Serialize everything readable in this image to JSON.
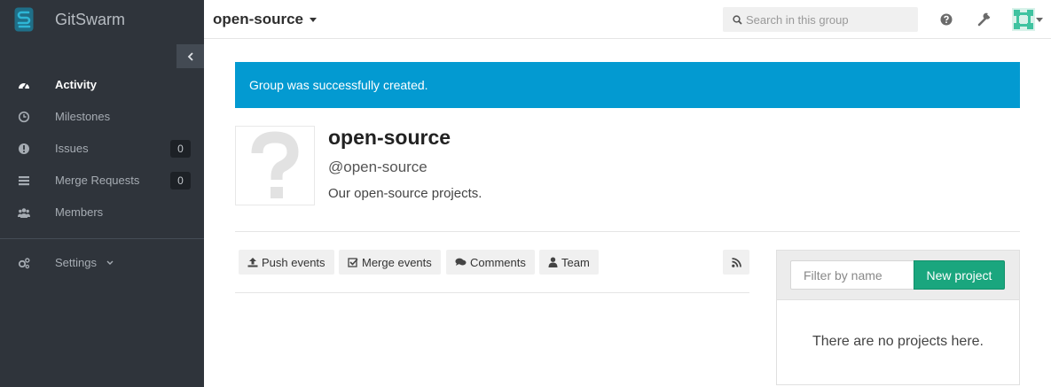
{
  "app": {
    "name": "GitSwarm"
  },
  "sidebar": {
    "items": [
      {
        "label": "Activity",
        "icon": "dashboard-icon",
        "active": true
      },
      {
        "label": "Milestones",
        "icon": "clock-icon"
      },
      {
        "label": "Issues",
        "icon": "exclamation-icon",
        "count": "0"
      },
      {
        "label": "Merge Requests",
        "icon": "list-icon",
        "count": "0"
      },
      {
        "label": "Members",
        "icon": "users-icon"
      }
    ],
    "settings_label": "Settings"
  },
  "header": {
    "group_title": "open-source",
    "search_placeholder": "Search in this group"
  },
  "flash": {
    "message": "Group was successfully created."
  },
  "group": {
    "name": "open-source",
    "path": "@open-source",
    "description": "Our open-source projects."
  },
  "event_filters": {
    "push": "Push events",
    "merge": "Merge events",
    "comments": "Comments",
    "team": "Team"
  },
  "projects": {
    "filter_placeholder": "Filter by name",
    "new_button": "New project",
    "empty_text": "There are no projects here."
  },
  "colors": {
    "sidebar_bg": "#2f343b",
    "flash_bg": "#039ad1",
    "new_project_bg": "#1aa67e",
    "brand_logo": "#2eb6d6"
  }
}
